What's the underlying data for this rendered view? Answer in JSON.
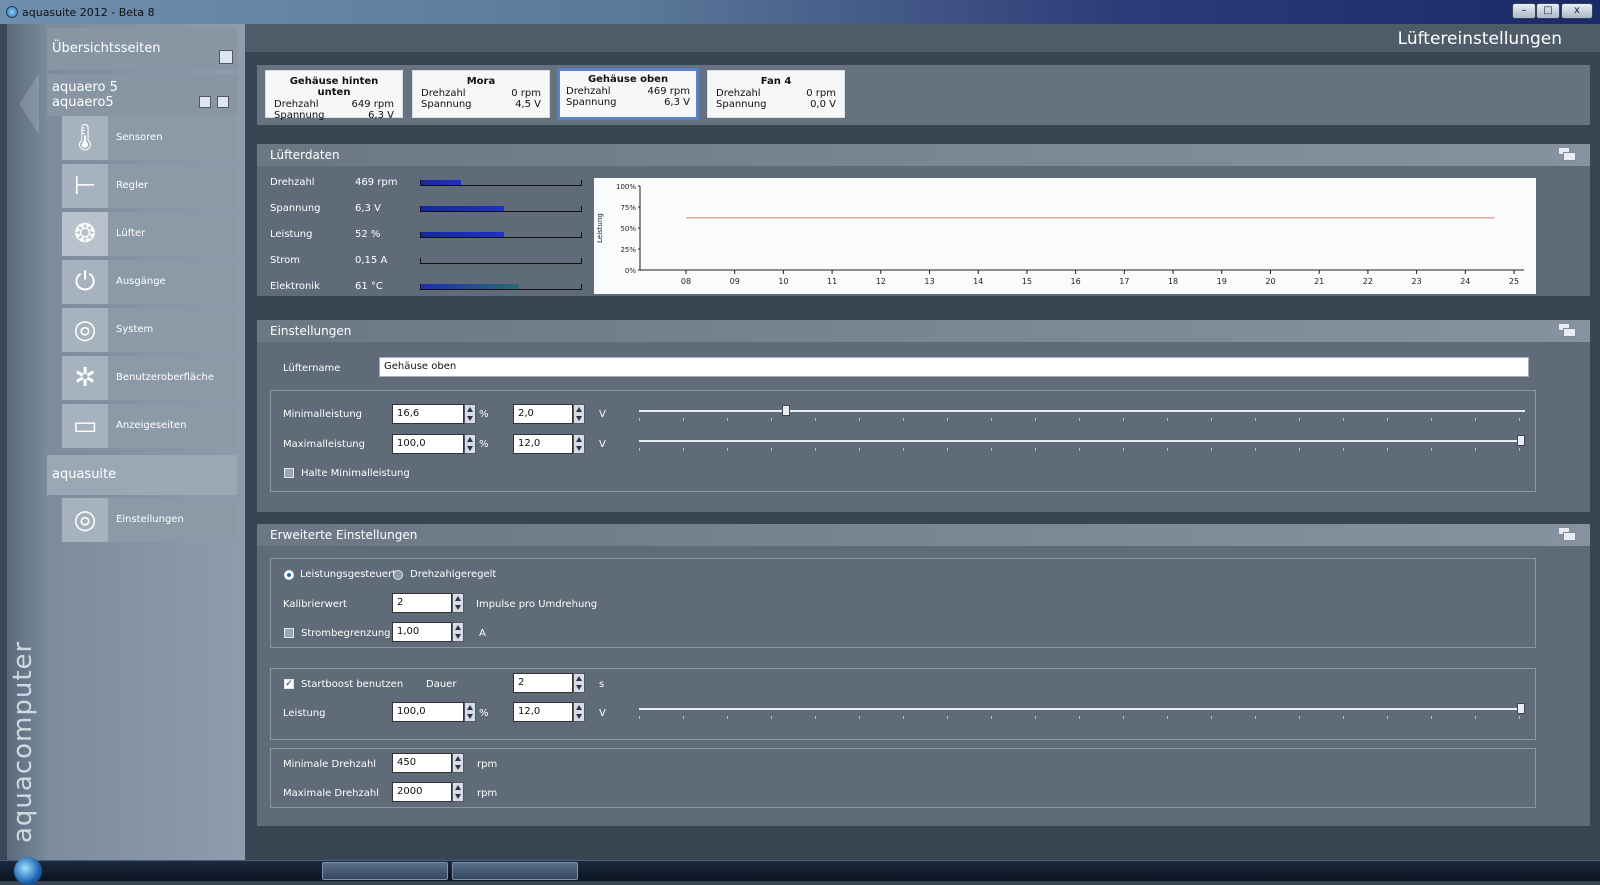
{
  "window": {
    "title": "aquasuite 2012 - Beta 8",
    "min": "–",
    "max": "□",
    "close": "x"
  },
  "brand": "aquacomputer",
  "sidebar": {
    "overview": "Übersichtsseiten",
    "device_line1": "aquaero 5",
    "device_line2": "aquaero5",
    "items": [
      {
        "label": "Sensoren",
        "icon": "thermometer-icon",
        "glyph": "🌡"
      },
      {
        "label": "Regler",
        "icon": "controller-icon",
        "glyph": "⊢"
      },
      {
        "label": "Lüfter",
        "icon": "fan-icon",
        "glyph": "❂"
      },
      {
        "label": "Ausgänge",
        "icon": "plug-icon",
        "glyph": "⏻"
      },
      {
        "label": "System",
        "icon": "system-icon",
        "glyph": "◎"
      },
      {
        "label": "Benutzeroberfläche",
        "icon": "brightness-icon",
        "glyph": "✲"
      },
      {
        "label": "Anzeigeseiten",
        "icon": "pages-icon",
        "glyph": "▭"
      }
    ],
    "aquasuite": "aquasuite",
    "settings_item": {
      "label": "Einstellungen",
      "icon": "settings-icon",
      "glyph": "◎"
    }
  },
  "header": {
    "title": "Lüftereinstellungen"
  },
  "fans": [
    {
      "name": "Gehäuse hinten unten",
      "speed_label": "Drehzahl",
      "speed": "649 rpm",
      "volt_label": "Spannung",
      "volt": "6,3 V"
    },
    {
      "name": "Mora",
      "speed_label": "Drehzahl",
      "speed": "0 rpm",
      "volt_label": "Spannung",
      "volt": "4,5 V"
    },
    {
      "name": "Gehäuse oben",
      "speed_label": "Drehzahl",
      "speed": "469 rpm",
      "volt_label": "Spannung",
      "volt": "6,3 V"
    },
    {
      "name": "Fan 4",
      "speed_label": "Drehzahl",
      "speed": "0 rpm",
      "volt_label": "Spannung",
      "volt": "0,0 V"
    }
  ],
  "fandata": {
    "title": "Lüfterdaten",
    "rows": [
      {
        "label": "Drehzahl",
        "value": "469 rpm",
        "fill": 0.25
      },
      {
        "label": "Spannung",
        "value": "6,3 V",
        "fill": 0.52
      },
      {
        "label": "Leistung",
        "value": "52 %",
        "fill": 0.52
      },
      {
        "label": "Strom",
        "value": "0,15 A",
        "fill": 0.0
      },
      {
        "label": "Elektronik",
        "value": "61 °C",
        "fill": 0.61
      }
    ]
  },
  "chart_data": {
    "type": "line",
    "ylabel": "Leistung",
    "ytick_labels": [
      "100%",
      "75%",
      "50%",
      "25%",
      "0%"
    ],
    "ylim": [
      0,
      100
    ],
    "x": [
      "08",
      "09",
      "10",
      "11",
      "12",
      "13",
      "14",
      "15",
      "16",
      "17",
      "18",
      "19",
      "20",
      "21",
      "22",
      "23",
      "24",
      "25"
    ],
    "series": [
      {
        "values": [
          62,
          62,
          62,
          62,
          62,
          62,
          62,
          62,
          62,
          62,
          62,
          62,
          62,
          62,
          62,
          62,
          62,
          62
        ],
        "x_start": "08",
        "x_end": "24.6"
      }
    ],
    "line_color": "#e07a70",
    "grid": false
  },
  "settings": {
    "title": "Einstellungen",
    "name_label": "Lüftername",
    "name_value": "Gehäuse oben",
    "min_label": "Minimalleistung",
    "min_pct": "16,6",
    "min_volt": "2,0",
    "max_label": "Maximalleistung",
    "max_pct": "100,0",
    "max_volt": "12,0",
    "pct_unit": "%",
    "volt_unit": "V",
    "min_slider": 0.166,
    "max_slider": 1.0,
    "hold_label": "Halte Minimalleistung"
  },
  "advanced": {
    "title": "Erweiterte Einstellungen",
    "mode_power": "Leistungsgesteuert",
    "mode_speed": "Drehzahlgeregelt",
    "calib_label": "Kalibrierwert",
    "calib_value": "2",
    "calib_unit": "Impulse pro Umdrehung",
    "current_label": "Strombegrenzung",
    "current_value": "1,00",
    "current_unit": "A",
    "boost_label": "Startboost benutzen",
    "duration_label": "Dauer",
    "duration_value": "2",
    "duration_unit": "s",
    "power_label": "Leistung",
    "power_pct": "100,0",
    "power_volt": "12,0",
    "pct_unit": "%",
    "volt_unit": "V",
    "power_slider": 1.0,
    "min_rpm_label": "Minimale Drehzahl",
    "min_rpm": "450",
    "max_rpm_label": "Maximale Drehzahl",
    "max_rpm": "2000",
    "rpm_unit": "rpm"
  }
}
